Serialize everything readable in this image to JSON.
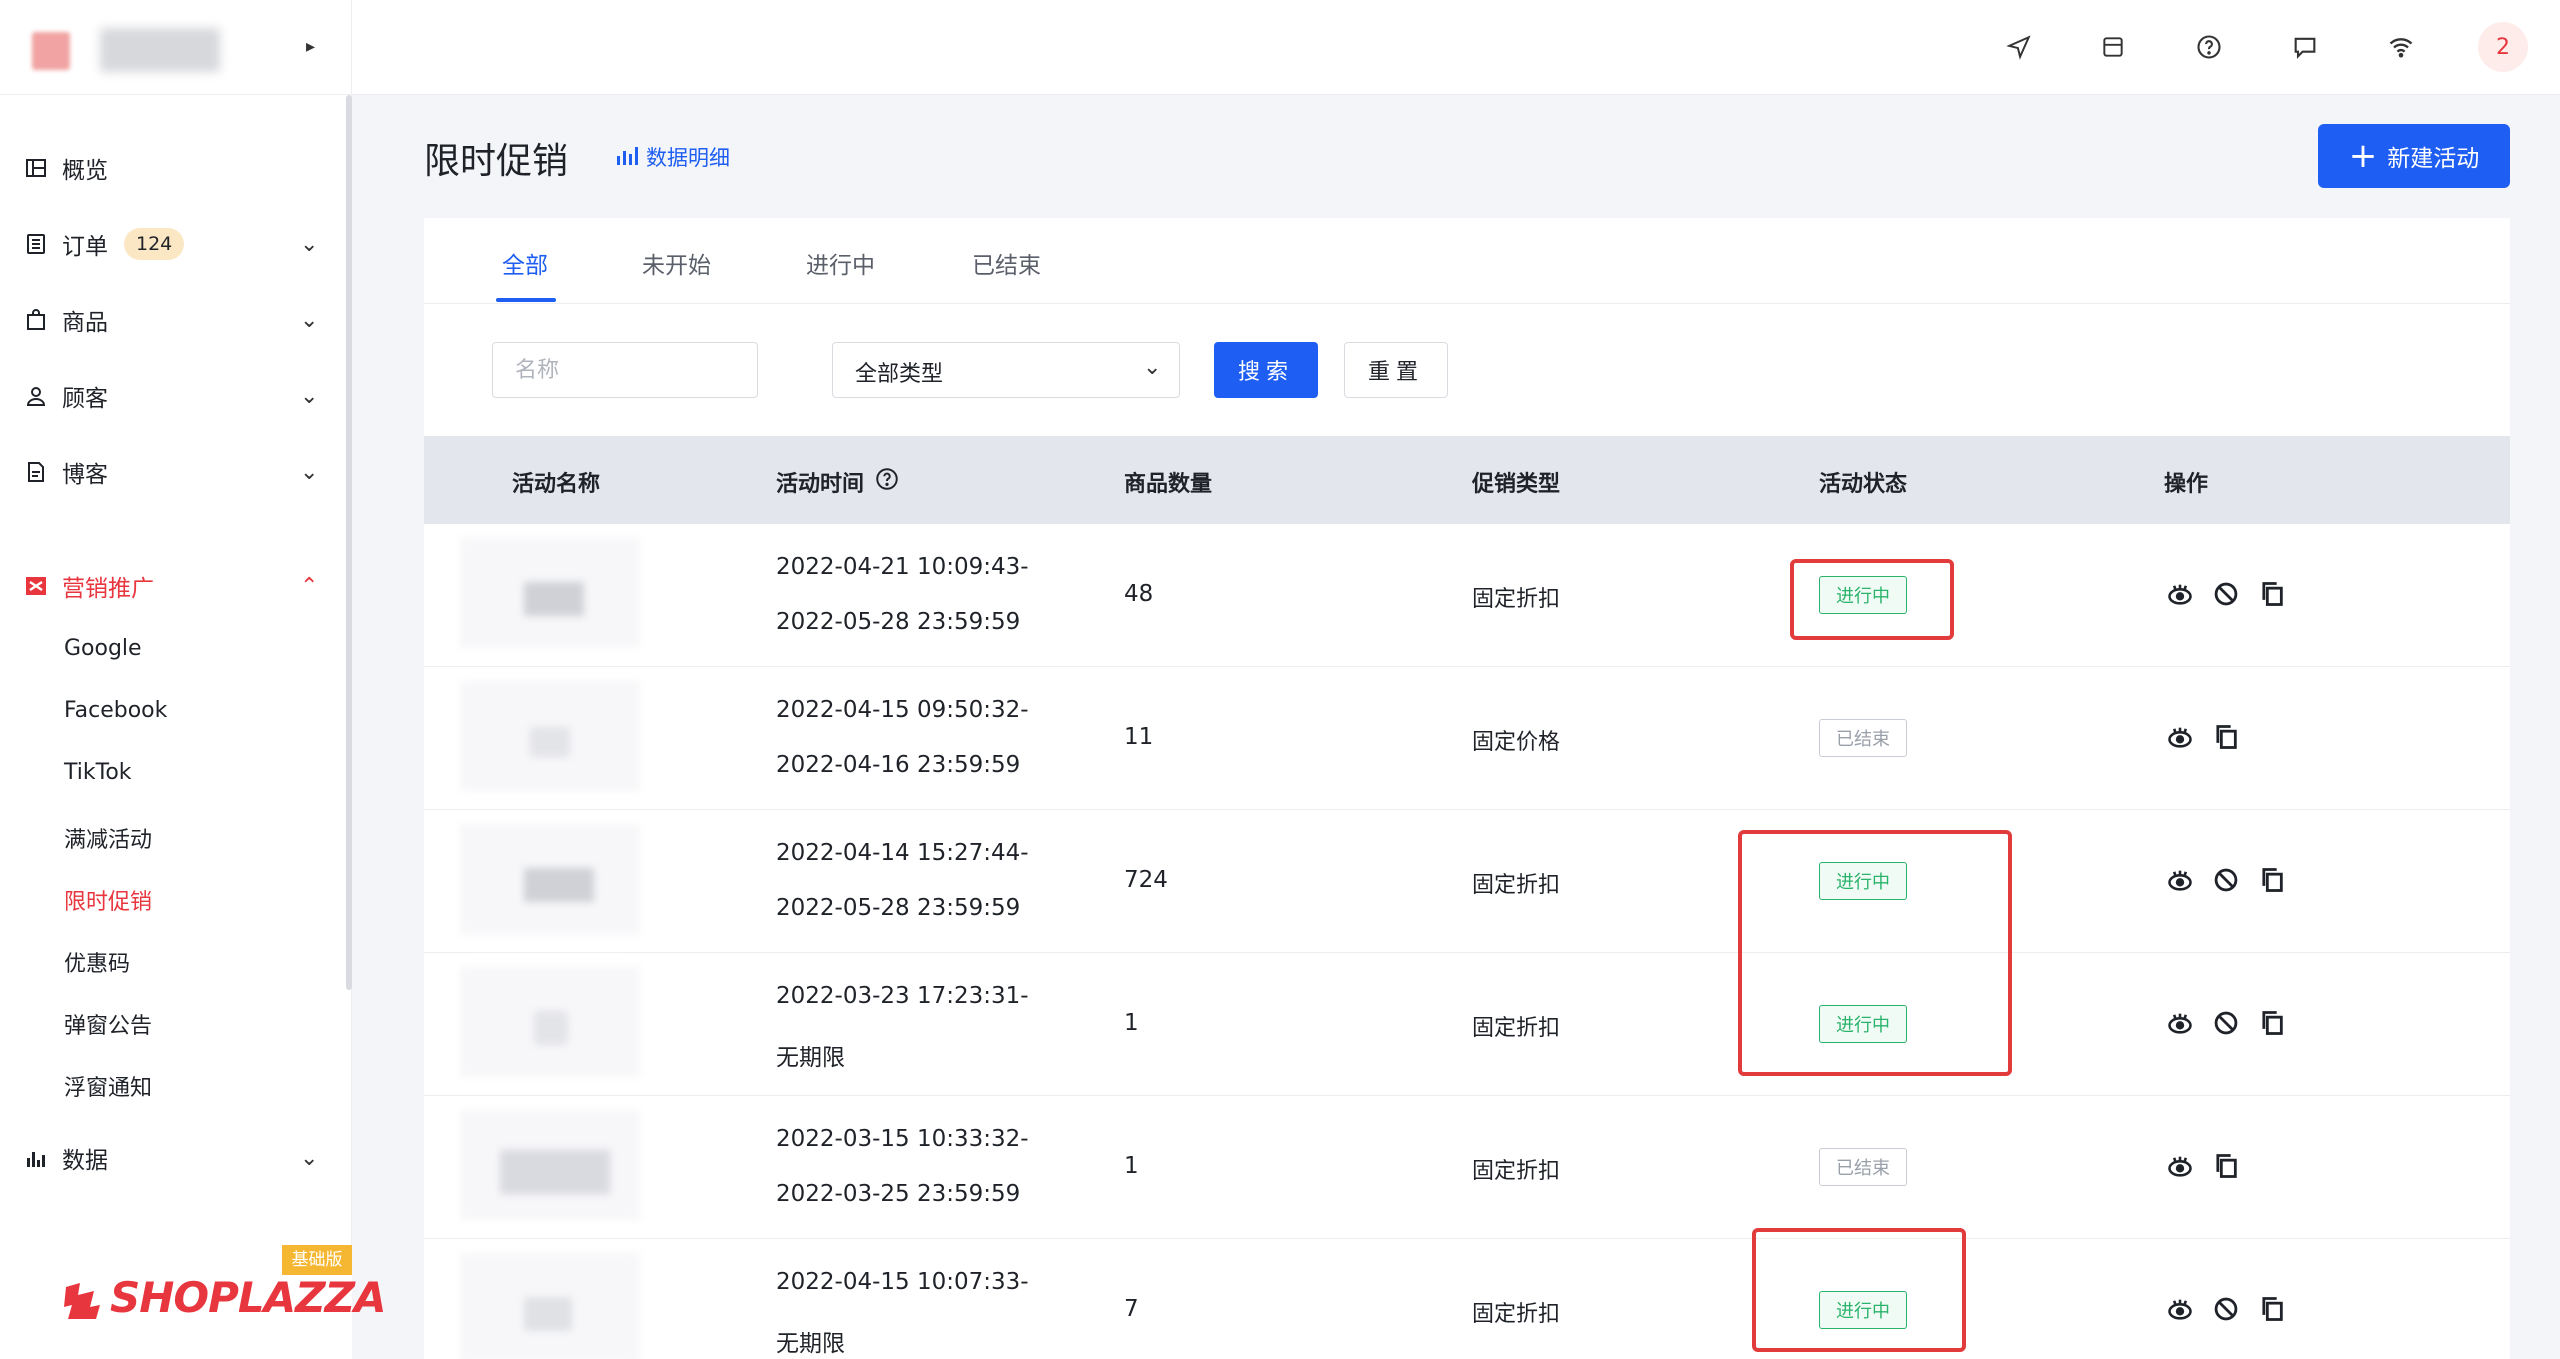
{
  "store": {
    "name": ""
  },
  "sidebar": {
    "items": [
      {
        "label": "概览",
        "icon": "dashboard-icon"
      },
      {
        "label": "订单",
        "icon": "orders-icon",
        "badge": "124"
      },
      {
        "label": "商品",
        "icon": "bag-icon"
      },
      {
        "label": "顾客",
        "icon": "user-icon"
      },
      {
        "label": "博客",
        "icon": "blog-icon"
      },
      {
        "label": "营销推广",
        "icon": "marketing-icon"
      },
      {
        "label": "数据",
        "icon": "chart-icon"
      }
    ],
    "marketing_sub": [
      "Google",
      "Facebook",
      "TikTok",
      "满减活动",
      "限时促销",
      "优惠码",
      "弹窗公告",
      "浮窗通知"
    ],
    "active_sub": "限时促销"
  },
  "brand": {
    "name": "SHOPLAZZA",
    "plan": "基础版"
  },
  "topbar": {
    "icons": [
      "send-icon",
      "store-icon",
      "help-icon",
      "message-icon",
      "wifi-icon"
    ],
    "avatar": "2"
  },
  "page": {
    "title": "限时促销",
    "data_link": "数据明细",
    "new_button": "新建活动"
  },
  "tabs": [
    "全部",
    "未开始",
    "进行中",
    "已结束"
  ],
  "filters": {
    "name_placeholder": "名称",
    "type_value": "全部类型",
    "search": "搜索",
    "reset": "重置"
  },
  "table": {
    "headers": [
      "活动名称",
      "活动时间",
      "商品数量",
      "促销类型",
      "活动状态",
      "操作"
    ],
    "rows": [
      {
        "start": "2022-04-21 10:09:43-",
        "end": "2022-05-28 23:59:59",
        "qty": "48",
        "type": "固定折扣",
        "status": "进行中",
        "active": true
      },
      {
        "start": "2022-04-15 09:50:32-",
        "end": "2022-04-16 23:59:59",
        "qty": "11",
        "type": "固定价格",
        "status": "已结束",
        "active": false
      },
      {
        "start": "2022-04-14 15:27:44-",
        "end": "2022-05-28 23:59:59",
        "qty": "724",
        "type": "固定折扣",
        "status": "进行中",
        "active": true
      },
      {
        "start": "2022-03-23 17:23:31-",
        "end": "无期限",
        "qty": "1",
        "type": "固定折扣",
        "status": "进行中",
        "active": true
      },
      {
        "start": "2022-03-15 10:33:32-",
        "end": "2022-03-25 23:59:59",
        "qty": "1",
        "type": "固定折扣",
        "status": "已结束",
        "active": false
      },
      {
        "start": "2022-04-15 10:07:33-",
        "end": "无期限",
        "qty": "7",
        "type": "固定折扣",
        "status": "进行中",
        "active": true
      }
    ]
  },
  "colors": {
    "accent": "#1e5ef3",
    "brand": "#e8363e",
    "status_on": "#29b36b",
    "status_off": "#9aa0aa",
    "highlight": "#e23b3b"
  }
}
